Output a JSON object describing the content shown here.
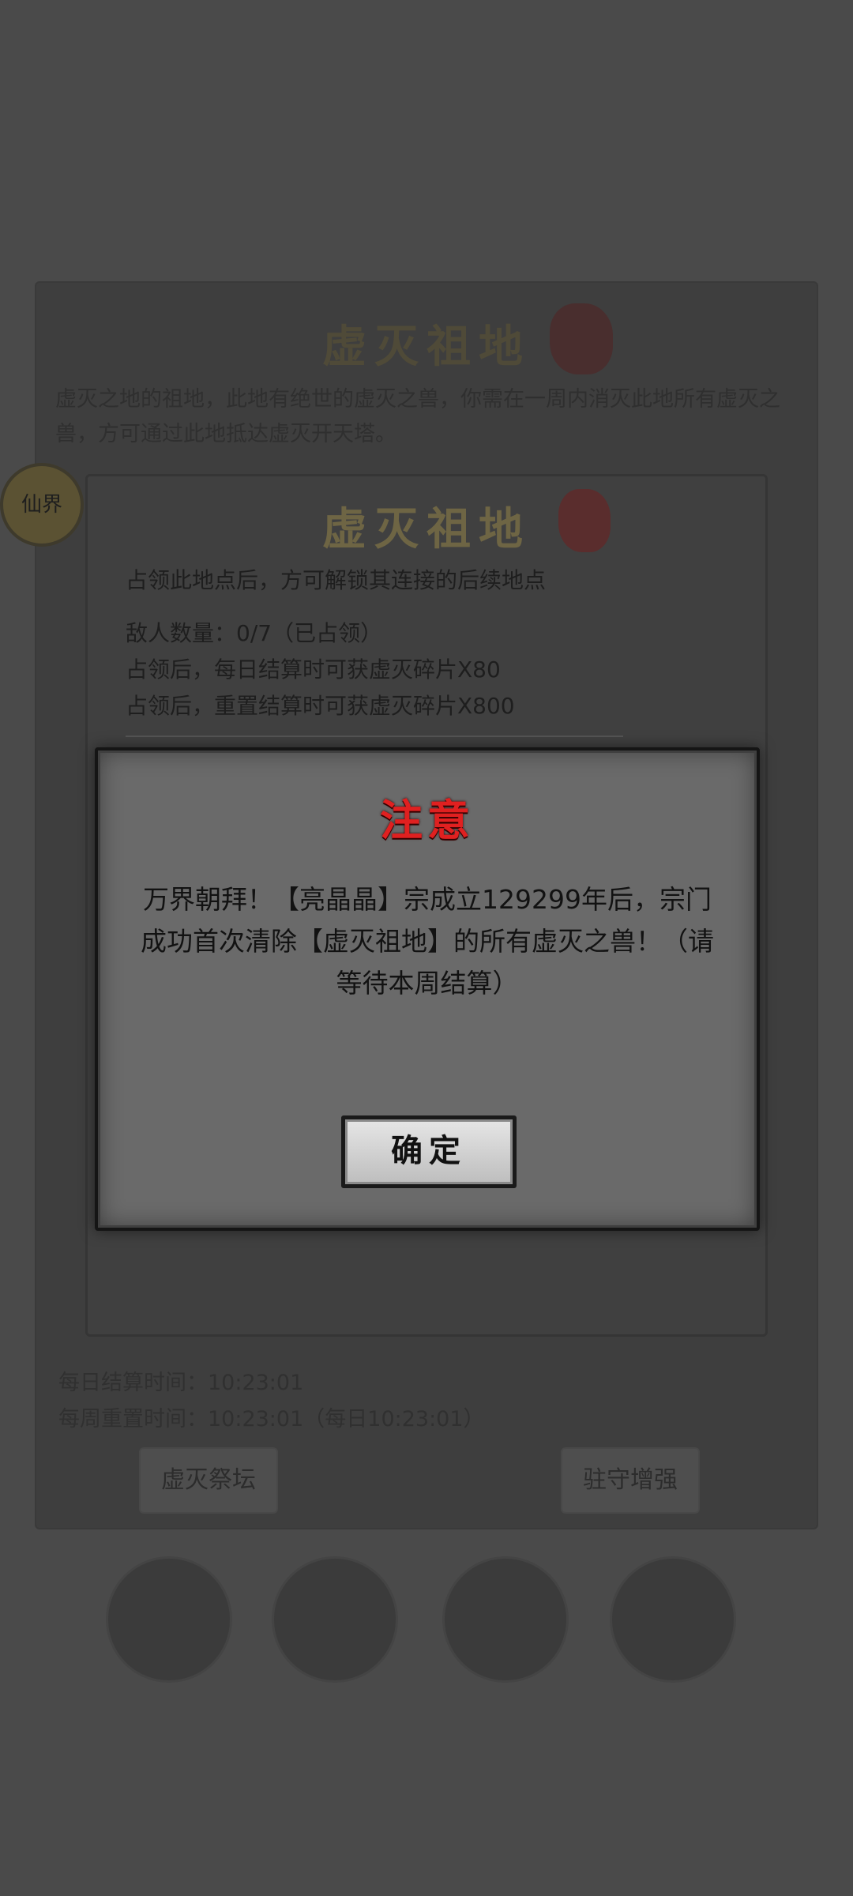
{
  "background_panel": {
    "title": "虚灭祖地",
    "description": "虚灭之地的祖地，此地有绝世的虚灭之兽，你需在一周内消灭此地所有虚灭之兽，方可通过此地抵达虚灭开天塔。",
    "daily_settle_time": "每日结算时间：10:23:01",
    "weekly_reset_time": "每周重置时间：10:23:01（每日10:23:01）",
    "altar_button": "虚灭祭坛",
    "guard_button": "驻守增强",
    "sect_emblem_text": "仙界"
  },
  "location_panel": {
    "title": "虚灭祖地",
    "subtitle": "占领此地点后，方可解锁其连接的后续地点",
    "enemy_count": "敌人数量：0/7（已占领）",
    "daily_reward": "占领后，每日结算时可获虚灭碎片X80",
    "reset_reward": "占领后，重置结算时可获虚灭碎片X800"
  },
  "dialog": {
    "title": "注意",
    "message": "万界朝拜！【亮晶晶】宗成立129299年后，宗门成功首次清除【虚灭祖地】的所有虚灭之兽！（请等待本周结算）",
    "confirm_button": "确定"
  },
  "colors": {
    "dialog_title": "#e02020",
    "dialog_bg": "#6a6a6a",
    "overlay_bg": "#4a4a4a"
  }
}
